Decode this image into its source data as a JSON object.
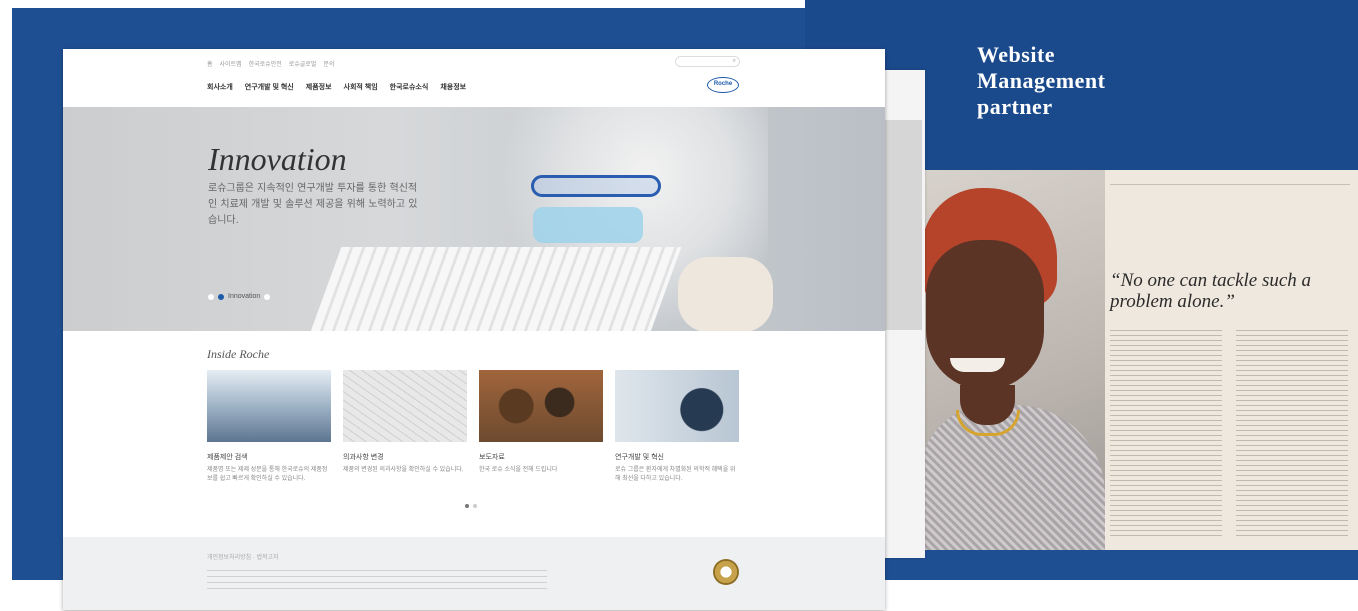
{
  "banner": {
    "heading_lines": [
      "Website",
      "Management",
      "partner"
    ],
    "brand_color": "#1f4f93"
  },
  "magazine": {
    "quote": "“No one can tackle such a problem alone.”"
  },
  "site": {
    "utility_links": [
      "홈",
      "사이트맵",
      "한국로슈안전",
      "로슈글로벌",
      "문의"
    ],
    "search_icon": "search-icon",
    "nav": [
      "회사소개",
      "연구개발 및 혁신",
      "제품정보",
      "사회적 책임",
      "한국로슈소식",
      "채용정보"
    ],
    "logo": "Roche",
    "hero": {
      "title": "Innovation",
      "description": "로슈그룹은 지속적인 연구개발 투자를 통한 혁신적인 치료제 개발 및 솔루션 제공을 위해 노력하고 있습니다.",
      "slider_label": "Innovation"
    },
    "inside": {
      "title": "Inside Roche",
      "cards": [
        {
          "title": "제품제안 검색",
          "text": "제품명 또는 제제 성분을 통해 한국로슈의 제품정보를 쉽고 빠르게 확인하실 수 있습니다."
        },
        {
          "title": "의과사항 변경",
          "text": "제품의 변경된 의과사항을 확인하실 수 있습니다."
        },
        {
          "title": "보도자료",
          "text": "한국 로슈 소식을 전해 드립니다"
        },
        {
          "title": "연구개발 및 혁신",
          "text": "로슈 그룹은 환자에게 차별화된 의학적 혜택을 위해 최선을 다하고 있습니다."
        }
      ]
    },
    "footer": {
      "links": "개인정보처리방침 · 법적고지"
    }
  }
}
